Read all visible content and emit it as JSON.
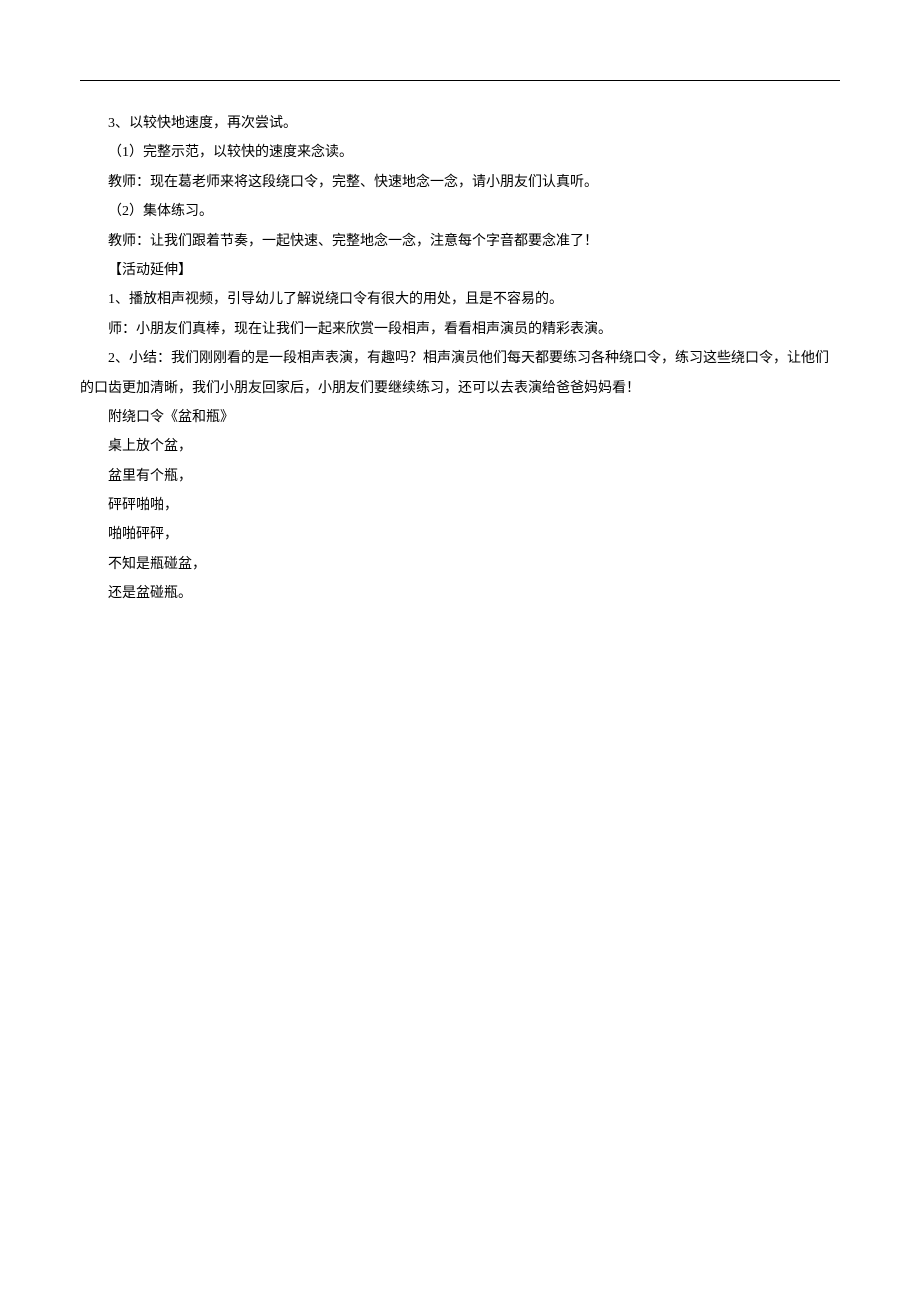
{
  "lines": [
    {
      "cls": "para",
      "text": "3、以较快地速度，再次尝试。"
    },
    {
      "cls": "para",
      "text": "（1）完整示范，以较快的速度来念读。"
    },
    {
      "cls": "para",
      "text": "教师：现在葛老师来将这段绕口令，完整、快速地念一念，请小朋友们认真听。"
    },
    {
      "cls": "para",
      "text": "（2）集体练习。"
    },
    {
      "cls": "para",
      "text": "教师：让我们跟着节奏，一起快速、完整地念一念，注意每个字音都要念准了！"
    },
    {
      "cls": "para",
      "text": "【活动延伸】"
    },
    {
      "cls": "para",
      "text": "1、播放相声视频，引导幼儿了解说绕口令有很大的用处，且是不容易的。"
    },
    {
      "cls": "para",
      "text": "师：小朋友们真棒，现在让我们一起来欣赏一段相声，看看相声演员的精彩表演。"
    },
    {
      "cls": "para",
      "text": "2、小结：我们刚刚看的是一段相声表演，有趣吗？相声演员他们每天都要练习各种绕口令，练习这些绕口令，让他们的口齿更加清晰，我们小朋友回家后，小朋友们要继续练习，还可以去表演给爸爸妈妈看！"
    },
    {
      "cls": "para",
      "text": "附绕口令《盆和瓶》"
    },
    {
      "cls": "para",
      "text": "桌上放个盆，"
    },
    {
      "cls": "para",
      "text": "盆里有个瓶，"
    },
    {
      "cls": "para",
      "text": "砰砰啪啪，"
    },
    {
      "cls": "para",
      "text": "啪啪砰砰，"
    },
    {
      "cls": "para",
      "text": "不知是瓶碰盆，"
    },
    {
      "cls": "para",
      "text": "还是盆碰瓶。"
    }
  ]
}
